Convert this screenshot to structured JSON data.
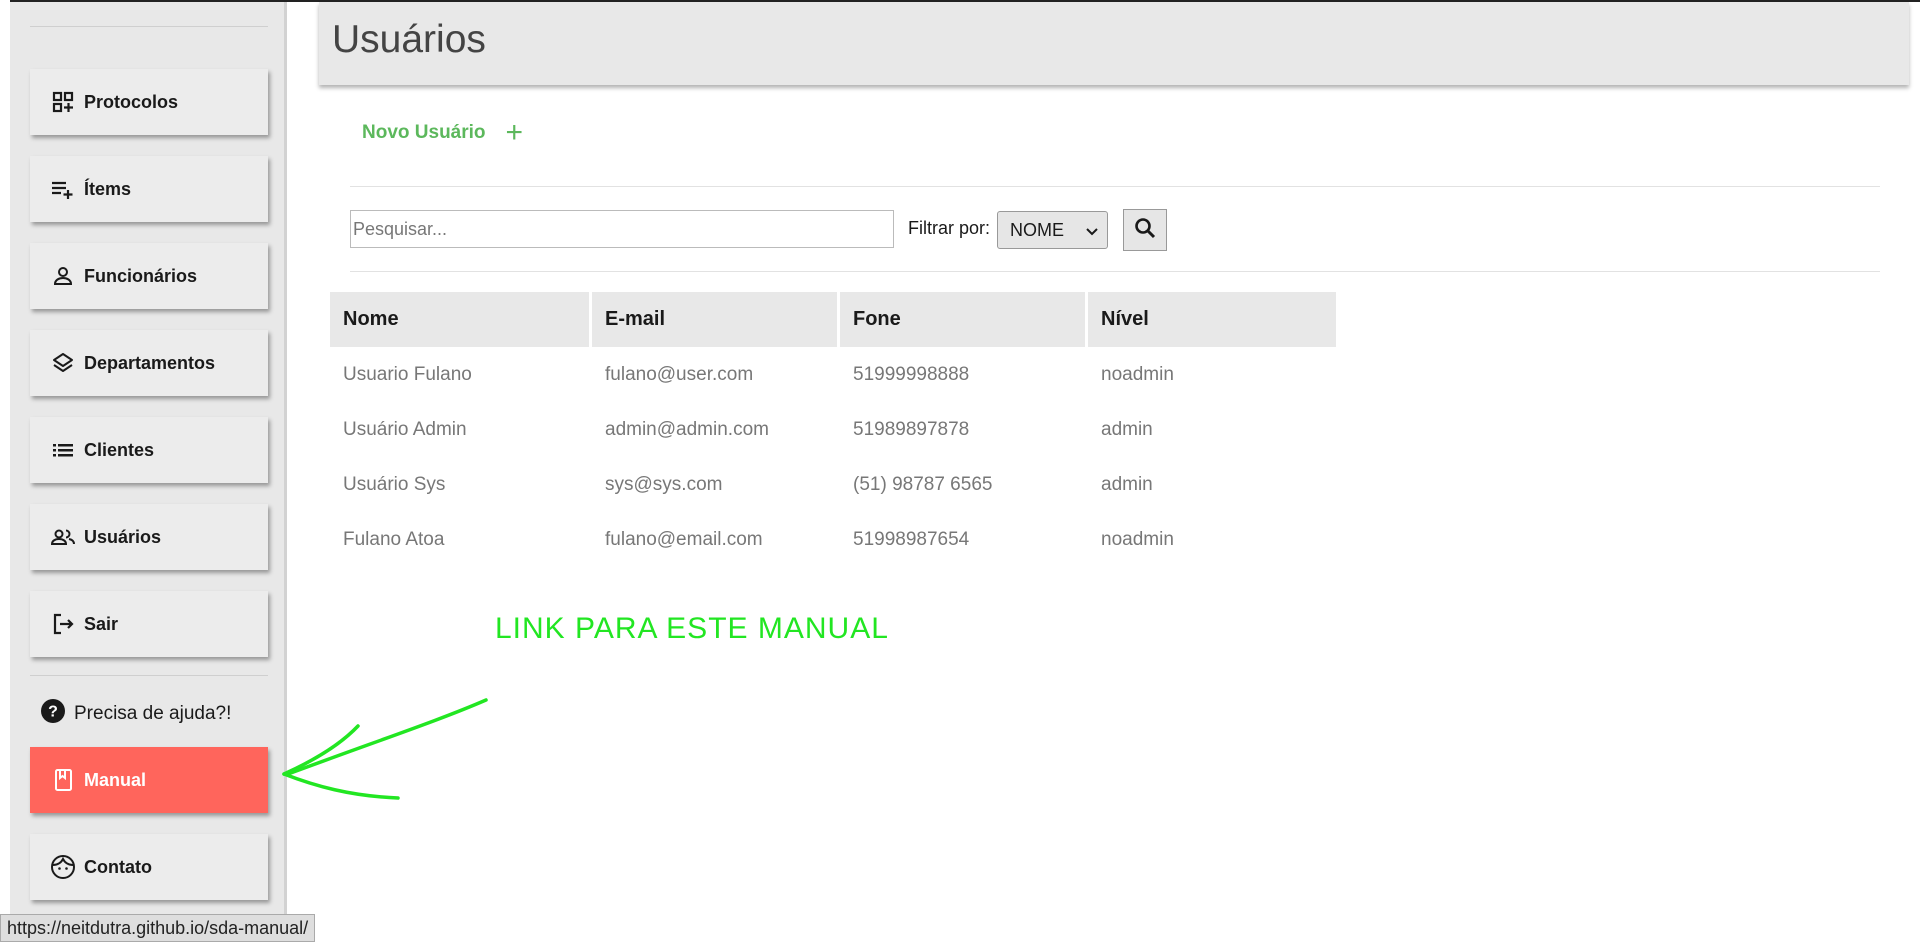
{
  "sidebar": {
    "items": [
      {
        "label": "Protocolos",
        "icon": "dashboard-add-icon"
      },
      {
        "label": "Ítems",
        "icon": "playlist-add-icon"
      },
      {
        "label": "Funcionários",
        "icon": "person-icon"
      },
      {
        "label": "Departamentos",
        "icon": "layers-icon"
      },
      {
        "label": "Clientes",
        "icon": "list-icon"
      },
      {
        "label": "Usuários",
        "icon": "people-icon"
      },
      {
        "label": "Sair",
        "icon": "logout-icon"
      }
    ],
    "help_text": "Precisa de ajuda?!",
    "manual_label": "Manual",
    "contact_label": "Contato"
  },
  "page": {
    "title": "Usuários"
  },
  "actions": {
    "new_user_label": "Novo Usuário",
    "new_user_icon": "+"
  },
  "search": {
    "placeholder": "Pesquisar...",
    "filter_label": "Filtrar por:",
    "filter_selected": "NOME"
  },
  "table": {
    "headers": [
      "Nome",
      "E-mail",
      "Fone",
      "Nível"
    ],
    "rows": [
      [
        "Usuario Fulano",
        "fulano@user.com",
        "51999998888",
        "noadmin"
      ],
      [
        "Usuário Admin",
        "admin@admin.com",
        "51989897878",
        "admin"
      ],
      [
        "Usuário Sys",
        "sys@sys.com",
        "(51) 98787 6565",
        "admin"
      ],
      [
        "Fulano Atoa",
        "fulano@email.com",
        "51998987654",
        "noadmin"
      ]
    ]
  },
  "annotation": {
    "text": "LINK PARA ESTE MANUAL",
    "color": "#22e622"
  },
  "status_bar": {
    "url": "https://neitdutra.github.io/sda-manual/"
  },
  "colors": {
    "accent_manual": "#ff655c",
    "new_user_green": "#5cb85c"
  }
}
